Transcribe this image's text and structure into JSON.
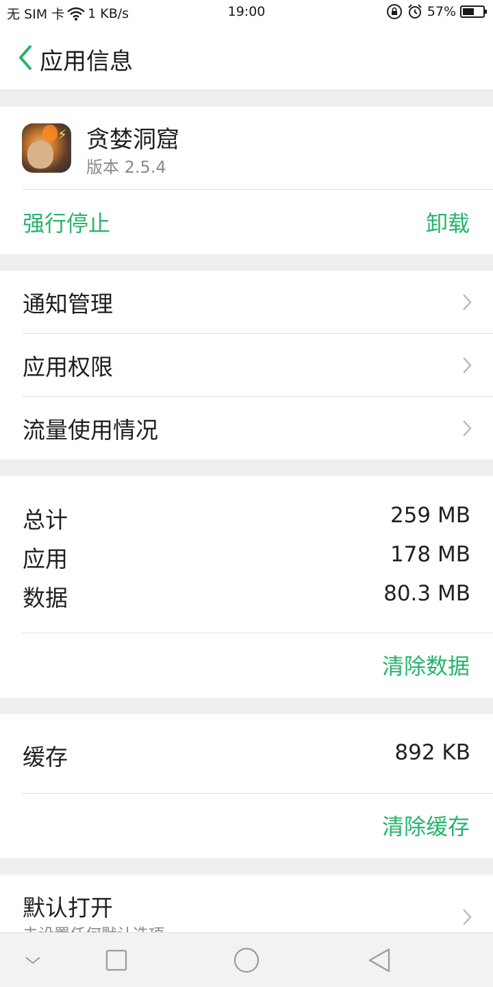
{
  "status_bar": {
    "sim": "无 SIM 卡",
    "speed": "1 KB/s",
    "time": "19:00",
    "battery": "57%",
    "battery_level": 0.57,
    "icons": [
      "wifi-icon",
      "rotation-lock-icon",
      "alarm-icon",
      "battery-icon"
    ]
  },
  "header": {
    "title": "应用信息",
    "back_icon": "chevron-left-icon"
  },
  "app": {
    "name": "贪婪洞窟",
    "version": "版本 2.5.4",
    "force_stop": "强行停止",
    "uninstall": "卸载"
  },
  "menu": {
    "items": [
      {
        "label": "通知管理"
      },
      {
        "label": "应用权限"
      },
      {
        "label": "流量使用情况"
      }
    ]
  },
  "storage": {
    "rows": [
      {
        "label": "总计",
        "value": "259 MB"
      },
      {
        "label": "应用",
        "value": "178 MB"
      },
      {
        "label": "数据",
        "value": "80.3 MB"
      }
    ],
    "clear_button": "清除数据"
  },
  "cache": {
    "label": "缓存",
    "value": "892 KB",
    "clear_button": "清除缓存"
  },
  "default_open": {
    "label": "默认打开",
    "subtitle": "未设置任何默认选项"
  },
  "nav_bar": {
    "icons": [
      "collapse-icon",
      "recents-icon",
      "home-icon",
      "back-icon"
    ]
  },
  "colors": {
    "accent": "#27b36b",
    "background": "#efefef",
    "card": "#ffffff"
  }
}
